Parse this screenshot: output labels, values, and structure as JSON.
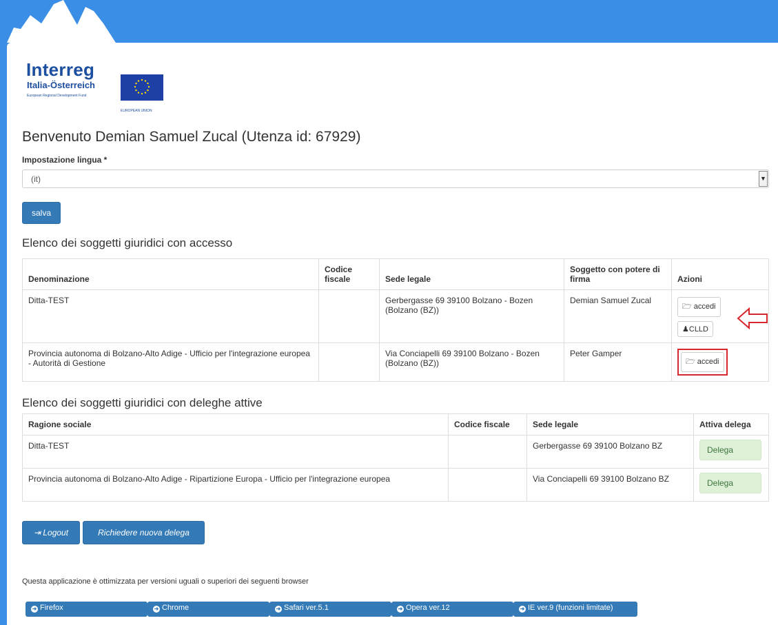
{
  "brand": {
    "name": "Interreg",
    "region": "Italia-Österreich",
    "fund": "European Regional Development Fund",
    "eu_label": "EUROPEAN UNION"
  },
  "welcome": "Benvenuto Demian Samuel Zucal (Utenza id: 67929)",
  "language": {
    "label": "Impostazione lingua *",
    "selected": "(it)",
    "save_label": "salva"
  },
  "access_section": {
    "title": "Elenco dei soggetti giuridici con accesso",
    "headers": [
      "Denominazione",
      "Codice fiscale",
      "Sede legale",
      "Soggetto con potere di firma",
      "Azioni"
    ],
    "rows": [
      {
        "denominazione": "Ditta-TEST",
        "codice_fiscale": "",
        "sede_legale": "Gerbergasse 69 39100 Bolzano - Bozen (Bolzano (BZ))",
        "firma": "Demian Samuel Zucal",
        "actions": [
          "accedi",
          "CLLD"
        ]
      },
      {
        "denominazione": "Provincia autonoma di Bolzano-Alto Adige - Ufficio per l'integrazione europea - Autorità di Gestione",
        "codice_fiscale": "",
        "sede_legale": "Via Conciapelli 69 39100 Bolzano - Bozen (Bolzano (BZ))",
        "firma": "Peter Gamper",
        "actions": [
          "accedi"
        ]
      }
    ]
  },
  "delegations_section": {
    "title": "Elenco dei soggetti giuridici con deleghe attive",
    "headers": [
      "Ragione sociale",
      "Codice fiscale",
      "Sede legale",
      "Attiva delega"
    ],
    "rows": [
      {
        "ragione_sociale": "Ditta-TEST",
        "codice_fiscale": "",
        "sede_legale": "Gerbergasse 69 39100 Bolzano BZ",
        "action": "Delega"
      },
      {
        "ragione_sociale": "Provincia autonoma di Bolzano-Alto Adige - Ripartizione Europa - Ufficio per l'integrazione europea",
        "codice_fiscale": "",
        "sede_legale": "Via Conciapelli 69 39100 Bolzano BZ",
        "action": "Delega"
      }
    ]
  },
  "footer": {
    "logout_label": "Logout",
    "request_label": "Richiedere nuova delega",
    "browser_note": "Questa applicazione è ottimizzata per versioni uguali o superiori dei seguenti browser",
    "browsers": [
      "Firefox",
      "Chrome",
      "Safari ver.5.1",
      "Opera ver.12",
      "IE ver.9 (funzioni limitate)"
    ]
  },
  "colors": {
    "header_blue": "#3a8ee6",
    "button_blue": "#337ab7",
    "highlight_red": "#d9262d",
    "delega_green": "#dff0d8"
  }
}
